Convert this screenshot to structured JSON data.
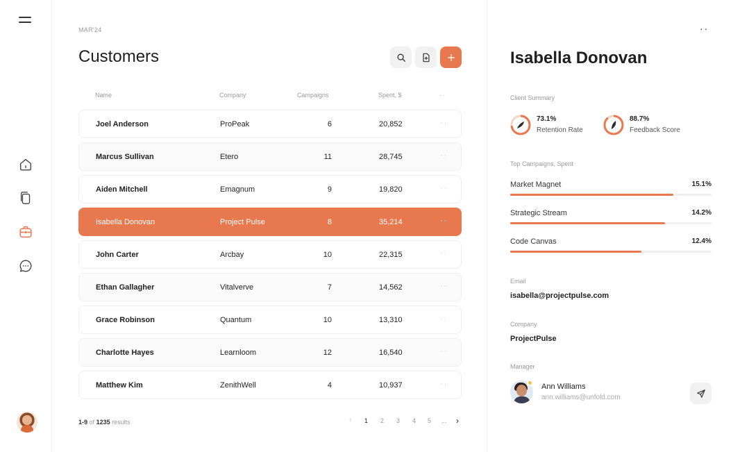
{
  "main": {
    "date_label": "MAR'24",
    "title": "Customers",
    "columns": {
      "name": "Name",
      "company": "Company",
      "campaigns": "Campaigns",
      "spent": "Spent, $",
      "more": "··"
    },
    "rows": [
      {
        "name": "Joel Anderson",
        "company": "ProPeak",
        "campaigns": "6",
        "spent": "20,852",
        "more": "··"
      },
      {
        "name": "Marcus Sullivan",
        "company": "Etero",
        "campaigns": "11",
        "spent": "28,745",
        "more": "··"
      },
      {
        "name": "Aiden Mitchell",
        "company": "Emagnum",
        "campaigns": "9",
        "spent": "19,820",
        "more": "··"
      },
      {
        "name": "Isabella Donovan",
        "company": "Project Pulse",
        "campaigns": "8",
        "spent": "35,214",
        "more": "··"
      },
      {
        "name": "John Carter",
        "company": "Arcbay",
        "campaigns": "10",
        "spent": "22,315",
        "more": "··"
      },
      {
        "name": "Ethan Gallagher",
        "company": "Vitalverve",
        "campaigns": "7",
        "spent": "14,562",
        "more": "··"
      },
      {
        "name": "Grace Robinson",
        "company": "Quantum",
        "campaigns": "10",
        "spent": "13,310",
        "more": "··"
      },
      {
        "name": "Charlotte Hayes",
        "company": "Learnloom",
        "campaigns": "12",
        "spent": "16,540",
        "more": "··"
      },
      {
        "name": "Matthew Kim",
        "company": "ZenithWell",
        "campaigns": "4",
        "spent": "10,937",
        "more": "··"
      }
    ],
    "selected_row": 3,
    "results": {
      "range": "1-9",
      "of": "of",
      "total": "1235",
      "suffix": "results"
    },
    "pagination": {
      "prev": "‹",
      "pages": [
        "1",
        "2",
        "3",
        "4",
        "5"
      ],
      "ellipsis": "...",
      "next": "›",
      "active": "1"
    }
  },
  "sidebar": {
    "items": [
      "menu-icon",
      "home-icon",
      "documents-icon",
      "briefcase-icon",
      "chat-icon"
    ],
    "active": "briefcase-icon"
  },
  "detail": {
    "more": "··",
    "name": "Isabella Donovan",
    "summary_label": "Client Summary",
    "stats": [
      {
        "value": "73.1%",
        "label": "Retention Rate",
        "level": 0.731
      },
      {
        "value": "88.7%",
        "label": "Feedback Score",
        "level": 0.887
      }
    ],
    "campaigns_label": "Top Campaigns, Spent",
    "campaigns": [
      {
        "name": "Market Magnet",
        "percent": "15.1%",
        "level": 0.81
      },
      {
        "name": "Strategic Stream",
        "percent": "14.2%",
        "level": 0.77
      },
      {
        "name": "Code Canvas",
        "percent": "12.4%",
        "level": 0.65
      }
    ],
    "email_label": "Email",
    "email": "isabella@projectpulse.com",
    "company_label": "Company",
    "company": "ProjectPulse",
    "manager_label": "Manager",
    "manager": {
      "name": "Ann Williams",
      "email": "ann.williams@unfold.com"
    }
  },
  "colors": {
    "accent": "#e8784d",
    "border": "#efefef",
    "muted": "#999999"
  }
}
